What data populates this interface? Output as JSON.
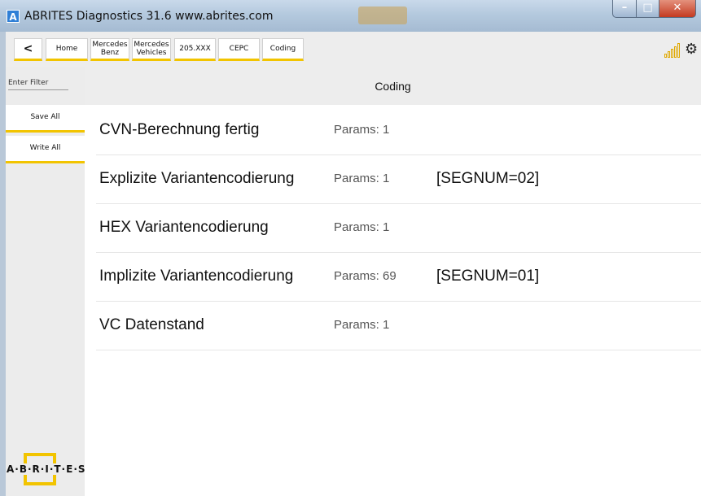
{
  "window": {
    "app_icon": "A",
    "title": "ABRITES Diagnostics 31.6   www.abrites.com",
    "minimize_label": "–",
    "maximize_label": "□",
    "close_label": "✕"
  },
  "toolbar": {
    "back_label": "<",
    "breadcrumbs": [
      "Home",
      "Mercedes Benz",
      "Mercedes Vehicles",
      "205.XXX",
      "CEPC",
      "Coding"
    ],
    "gear_icon": "⚙",
    "accent_color": "#f2c400"
  },
  "sidebar": {
    "filter_placeholder": "Enter Filter",
    "save_all": "Save All",
    "write_all": "Write All",
    "logo_text": "A·B·R·I·T·E·S"
  },
  "main": {
    "title": "Coding",
    "rows": [
      {
        "name": "CVN-Berechnung fertig",
        "params": "Params: 1",
        "seg": ""
      },
      {
        "name": "Explizite Variantencodierung",
        "params": "Params: 1",
        "seg": "[SEGNUM=02]"
      },
      {
        "name": "HEX Variantencodierung",
        "params": "Params: 1",
        "seg": ""
      },
      {
        "name": "Implizite Variantencodierung",
        "params": "Params: 69",
        "seg": "[SEGNUM=01]"
      },
      {
        "name": "VC Datenstand",
        "params": "Params: 1",
        "seg": ""
      }
    ]
  }
}
